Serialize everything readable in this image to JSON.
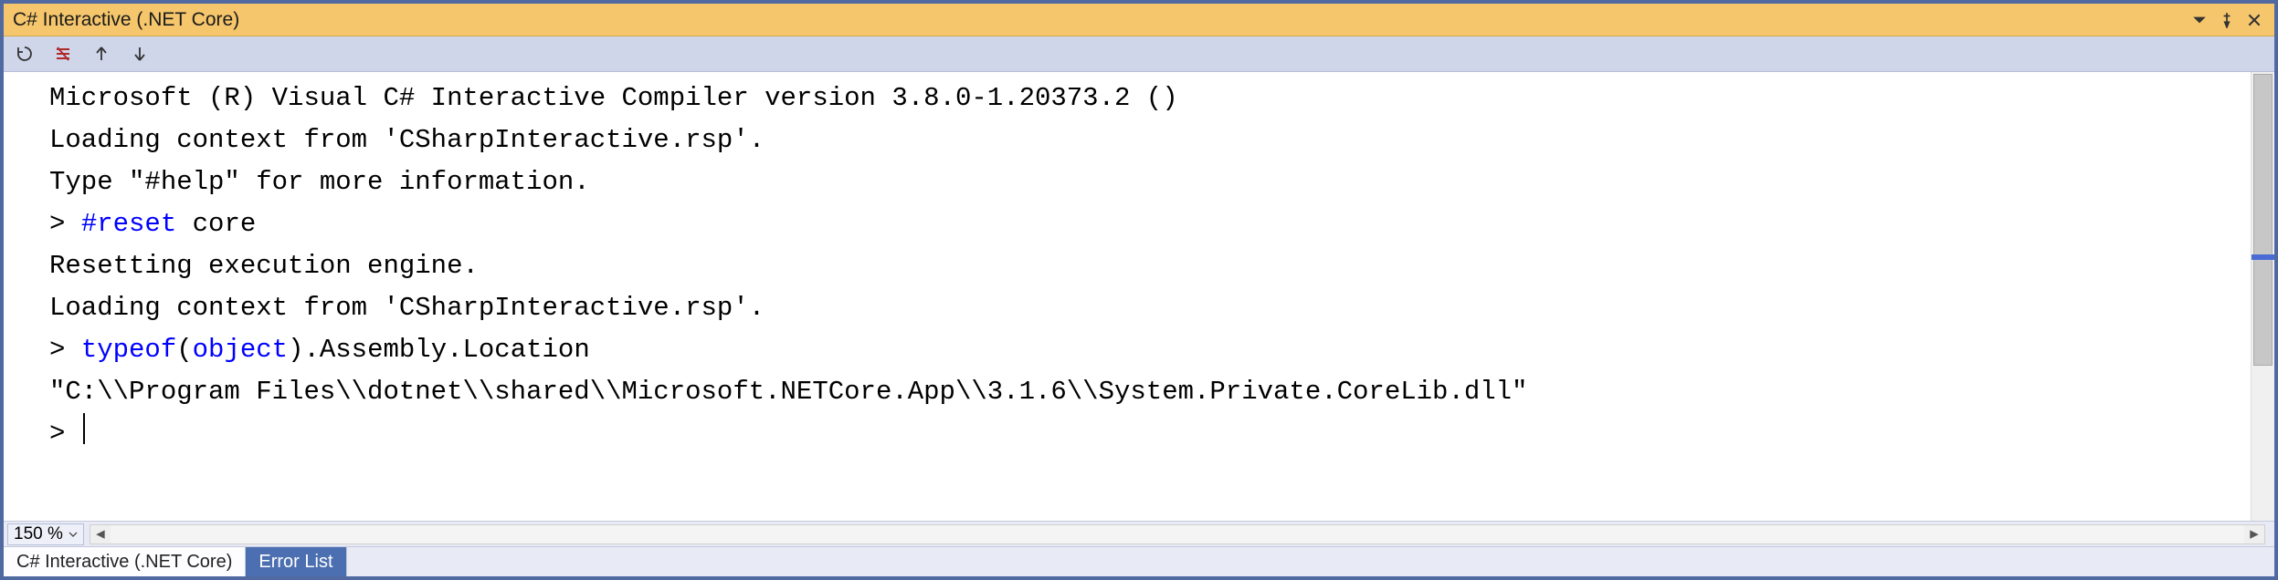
{
  "title": "C# Interactive (.NET Core)",
  "toolbar": {
    "reset_icon": "reset",
    "clear_icon": "clear",
    "up_icon": "history-prev",
    "down_icon": "history-next"
  },
  "console": {
    "lines": [
      {
        "type": "out",
        "text": "Microsoft (R) Visual C# Interactive Compiler version 3.8.0-1.20373.2 ()"
      },
      {
        "type": "out",
        "text": "Loading context from 'CSharpInteractive.rsp'."
      },
      {
        "type": "out",
        "text": "Type \"#help\" for more information."
      },
      {
        "type": "in",
        "segments": [
          {
            "t": "> ",
            "c": "prompt"
          },
          {
            "t": "#reset",
            "c": "kw-blue"
          },
          {
            "t": " core",
            "c": ""
          }
        ]
      },
      {
        "type": "out",
        "text": "Resetting execution engine."
      },
      {
        "type": "out",
        "text": "Loading context from 'CSharpInteractive.rsp'."
      },
      {
        "type": "in",
        "segments": [
          {
            "t": "> ",
            "c": "prompt"
          },
          {
            "t": "typeof",
            "c": "kw-blue"
          },
          {
            "t": "(",
            "c": ""
          },
          {
            "t": "object",
            "c": "kw-blue"
          },
          {
            "t": ").Assembly.Location",
            "c": ""
          }
        ]
      },
      {
        "type": "out",
        "text": "\"C:\\\\Program Files\\\\dotnet\\\\shared\\\\Microsoft.NETCore.App\\\\3.1.6\\\\System.Private.CoreLib.dll\""
      },
      {
        "type": "prompt",
        "text": "> "
      }
    ]
  },
  "status": {
    "zoom": "150 %"
  },
  "tabs": [
    {
      "label": "C# Interactive (.NET Core)",
      "active": true
    },
    {
      "label": "Error List",
      "active": false
    }
  ]
}
